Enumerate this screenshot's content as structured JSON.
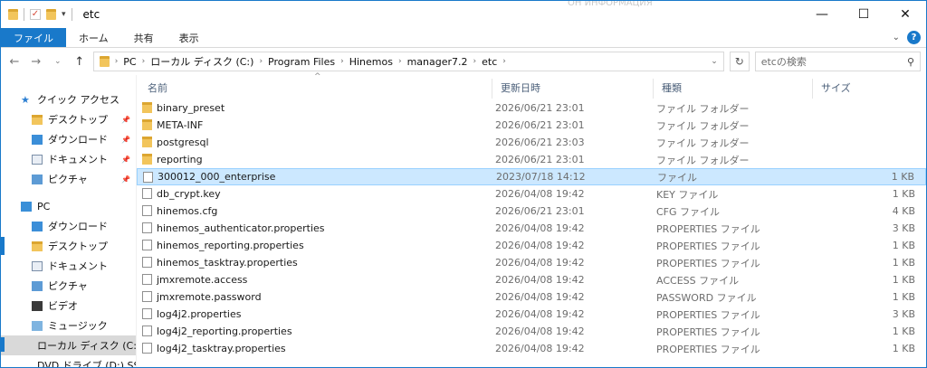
{
  "window": {
    "title": "etc",
    "ghost_text": "ОН ИНФОРМАЦИЯ",
    "controls": {
      "minimize": "—",
      "maximize": "☐",
      "close": "✕"
    }
  },
  "ribbon": {
    "tabs": [
      "ファイル",
      "ホーム",
      "共有",
      "表示"
    ],
    "help": "?"
  },
  "address": {
    "crumbs": [
      "PC",
      "ローカル ディスク (C:)",
      "Program Files",
      "Hinemos",
      "manager7.2",
      "etc"
    ],
    "search_placeholder": "etcの検索"
  },
  "nav": {
    "items": [
      {
        "label": "クイック アクセス",
        "icon": "star-icon",
        "level": "top",
        "pinned": false
      },
      {
        "label": "デスクトップ",
        "icon": "desktop-icon",
        "level": "sub",
        "pinned": true
      },
      {
        "label": "ダウンロード",
        "icon": "download-icon",
        "level": "sub",
        "pinned": true
      },
      {
        "label": "ドキュメント",
        "icon": "document-icon",
        "level": "sub",
        "pinned": true
      },
      {
        "label": "ピクチャ",
        "icon": "picture-icon",
        "level": "sub",
        "pinned": true
      },
      {
        "label": "",
        "icon": "",
        "level": "spacer",
        "pinned": false
      },
      {
        "label": "PC",
        "icon": "pc-icon",
        "level": "top",
        "pinned": false
      },
      {
        "label": "ダウンロード",
        "icon": "download-icon",
        "level": "sub",
        "pinned": false
      },
      {
        "label": "デスクトップ",
        "icon": "desktop-icon",
        "level": "sub",
        "pinned": false
      },
      {
        "label": "ドキュメント",
        "icon": "document-icon",
        "level": "sub",
        "pinned": false
      },
      {
        "label": "ピクチャ",
        "icon": "picture-icon",
        "level": "sub",
        "pinned": false
      },
      {
        "label": "ビデオ",
        "icon": "video-icon",
        "level": "sub",
        "pinned": false
      },
      {
        "label": "ミュージック",
        "icon": "music-icon",
        "level": "sub",
        "pinned": false
      },
      {
        "label": "ローカル ディスク (C:)",
        "icon": "drive-icon",
        "level": "sub",
        "pinned": false,
        "selected": true
      },
      {
        "label": "DVD ドライブ (D:) SSS",
        "icon": "dvd-icon",
        "level": "sub",
        "pinned": false
      }
    ]
  },
  "columns": {
    "name": "名前",
    "date": "更新日時",
    "type": "種類",
    "size": "サイズ"
  },
  "files": [
    {
      "name": "binary_preset",
      "date": "2026/06/21 23:01",
      "type": "ファイル フォルダー",
      "size": "",
      "kind": "folder"
    },
    {
      "name": "META-INF",
      "date": "2026/06/21 23:01",
      "type": "ファイル フォルダー",
      "size": "",
      "kind": "folder"
    },
    {
      "name": "postgresql",
      "date": "2026/06/21 23:03",
      "type": "ファイル フォルダー",
      "size": "",
      "kind": "folder"
    },
    {
      "name": "reporting",
      "date": "2026/06/21 23:01",
      "type": "ファイル フォルダー",
      "size": "",
      "kind": "folder"
    },
    {
      "name": "300012_000_enterprise",
      "date": "2023/07/18 14:12",
      "type": "ファイル",
      "size": "1 KB",
      "kind": "file",
      "selected": true
    },
    {
      "name": "db_crypt.key",
      "date": "2026/04/08 19:42",
      "type": "KEY ファイル",
      "size": "1 KB",
      "kind": "file"
    },
    {
      "name": "hinemos.cfg",
      "date": "2026/06/21 23:01",
      "type": "CFG ファイル",
      "size": "4 KB",
      "kind": "file"
    },
    {
      "name": "hinemos_authenticator.properties",
      "date": "2026/04/08 19:42",
      "type": "PROPERTIES ファイル",
      "size": "3 KB",
      "kind": "file"
    },
    {
      "name": "hinemos_reporting.properties",
      "date": "2026/04/08 19:42",
      "type": "PROPERTIES ファイル",
      "size": "1 KB",
      "kind": "file"
    },
    {
      "name": "hinemos_tasktray.properties",
      "date": "2026/04/08 19:42",
      "type": "PROPERTIES ファイル",
      "size": "1 KB",
      "kind": "file"
    },
    {
      "name": "jmxremote.access",
      "date": "2026/04/08 19:42",
      "type": "ACCESS ファイル",
      "size": "1 KB",
      "kind": "file"
    },
    {
      "name": "jmxremote.password",
      "date": "2026/04/08 19:42",
      "type": "PASSWORD ファイル",
      "size": "1 KB",
      "kind": "file"
    },
    {
      "name": "log4j2.properties",
      "date": "2026/04/08 19:42",
      "type": "PROPERTIES ファイル",
      "size": "3 KB",
      "kind": "file"
    },
    {
      "name": "log4j2_reporting.properties",
      "date": "2026/04/08 19:42",
      "type": "PROPERTIES ファイル",
      "size": "1 KB",
      "kind": "file"
    },
    {
      "name": "log4j2_tasktray.properties",
      "date": "2026/04/08 19:42",
      "type": "PROPERTIES ファイル",
      "size": "1 KB",
      "kind": "file"
    }
  ],
  "colors": {
    "accent": "#1979ca",
    "selection": "#cce8ff",
    "folder": "#f2c55c"
  }
}
